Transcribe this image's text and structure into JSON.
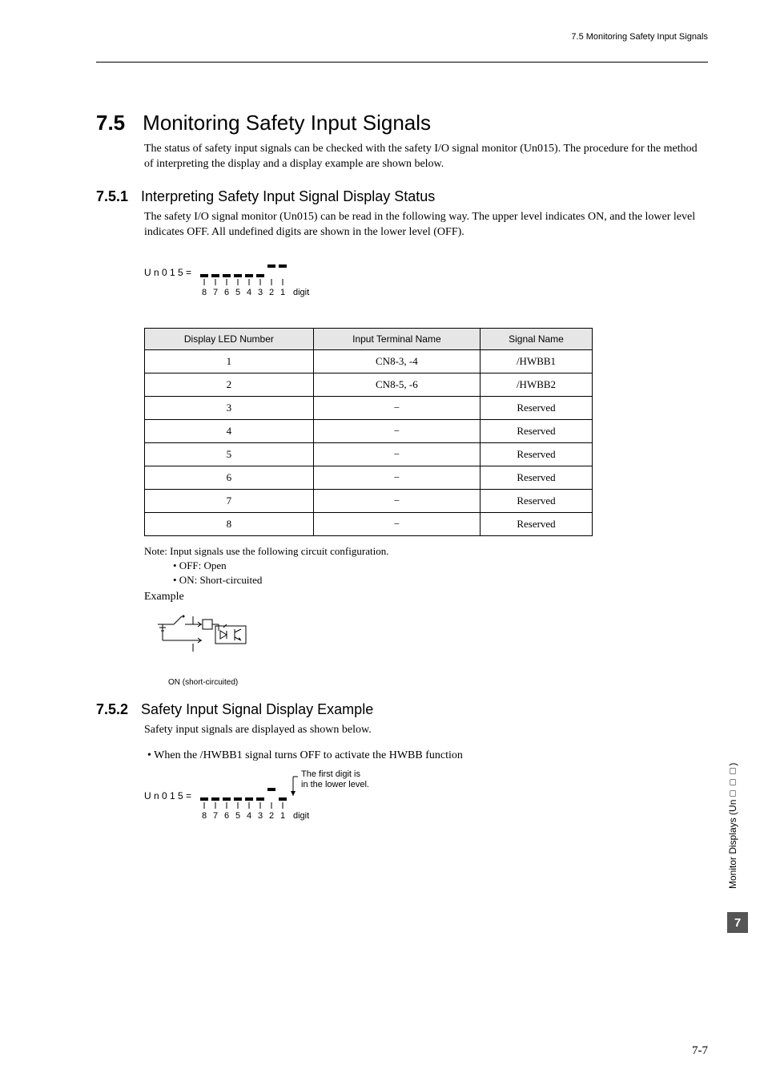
{
  "header": {
    "breadcrumb": "7.5  Monitoring Safety Input Signals"
  },
  "section": {
    "num": "7.5",
    "title": "Monitoring Safety Input Signals",
    "intro": "The status of safety input signals can be checked with the safety I/O signal monitor (Un015). The procedure for the method of interpreting the display and a display example are shown below."
  },
  "sub1": {
    "num": "7.5.1",
    "title": "Interpreting Safety Input Signal Display Status",
    "text": "The safety I/O signal monitor (Un015) can be read in the following way. The upper level indicates ON, and the lower level indicates OFF. All undefined digits are shown in the lower level (OFF).",
    "diagram_label": "U n 0 1 5 =",
    "digits": [
      "8",
      "7",
      "6",
      "5",
      "4",
      "3",
      "2",
      "1"
    ],
    "digit_word": "digit"
  },
  "table": {
    "headers": [
      "Display LED Number",
      "Input Terminal Name",
      "Signal Name"
    ],
    "rows": [
      [
        "1",
        "CN8-3, -4",
        "/HWBB1"
      ],
      [
        "2",
        "CN8-5, -6",
        "/HWBB2"
      ],
      [
        "3",
        "−",
        "Reserved"
      ],
      [
        "4",
        "−",
        "Reserved"
      ],
      [
        "5",
        "−",
        "Reserved"
      ],
      [
        "6",
        "−",
        "Reserved"
      ],
      [
        "7",
        "−",
        "Reserved"
      ],
      [
        "8",
        "−",
        "Reserved"
      ]
    ]
  },
  "note": {
    "prefix": "Note:",
    "text": "Input signals use the following circuit configuration.",
    "bullet1": "• OFF: Open",
    "bullet2": "• ON: Short-circuited"
  },
  "example": {
    "label": "Example",
    "caption": "ON (short-circuited)"
  },
  "sub2": {
    "num": "7.5.2",
    "title": "Safety Input Signal Display Example",
    "text": "Safety input signals are displayed as shown below.",
    "bullet": "• When the /HWBB1 signal turns OFF to activate the HWBB function",
    "diagram_label": "U n 0 1 5 =",
    "annotation1": "The first digit is",
    "annotation2": "in the lower level.",
    "digits": [
      "8",
      "7",
      "6",
      "5",
      "4",
      "3",
      "2",
      "1"
    ],
    "digit_word": "digit"
  },
  "sidetab": {
    "text": "Monitor Displays (Un□□□)",
    "num": "7"
  },
  "page_num": "7-7"
}
